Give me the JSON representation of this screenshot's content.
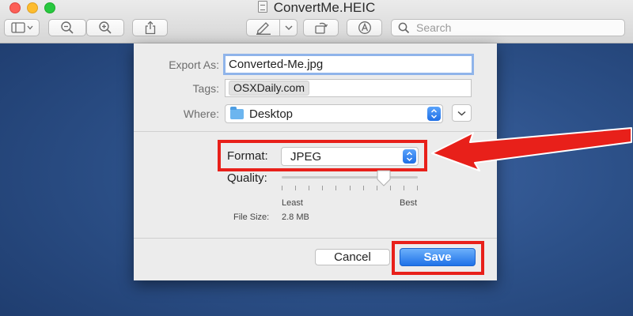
{
  "window": {
    "title": "ConvertMe.HEIC"
  },
  "toolbar": {
    "search_placeholder": "Search",
    "buttons": [
      {
        "name": "sidebar-toggle",
        "icon": "sidebar-icon"
      },
      {
        "name": "zoom-out",
        "icon": "zoom-out-icon"
      },
      {
        "name": "zoom-in",
        "icon": "zoom-in-icon"
      },
      {
        "name": "share",
        "icon": "share-icon"
      },
      {
        "name": "markup",
        "icon": "pen-icon"
      },
      {
        "name": "rotate",
        "icon": "rotate-icon"
      },
      {
        "name": "annotate",
        "icon": "annotate-icon"
      }
    ]
  },
  "export_dialog": {
    "export_as_label": "Export As:",
    "export_as_value": "Converted-Me.jpg",
    "tags_label": "Tags:",
    "tag_value": "OSXDaily.com",
    "where_label": "Where:",
    "where_value": "Desktop",
    "format_label": "Format:",
    "format_value": "JPEG",
    "quality_label": "Quality:",
    "quality_level": 0.75,
    "quality_min_label": "Least",
    "quality_max_label": "Best",
    "file_size_label": "File Size:",
    "file_size_value": "2.8 MB",
    "cancel_label": "Cancel",
    "save_label": "Save"
  },
  "colors": {
    "highlight": "#e8201a",
    "accent": "#1f72e8",
    "desktop": "#2c5088"
  }
}
